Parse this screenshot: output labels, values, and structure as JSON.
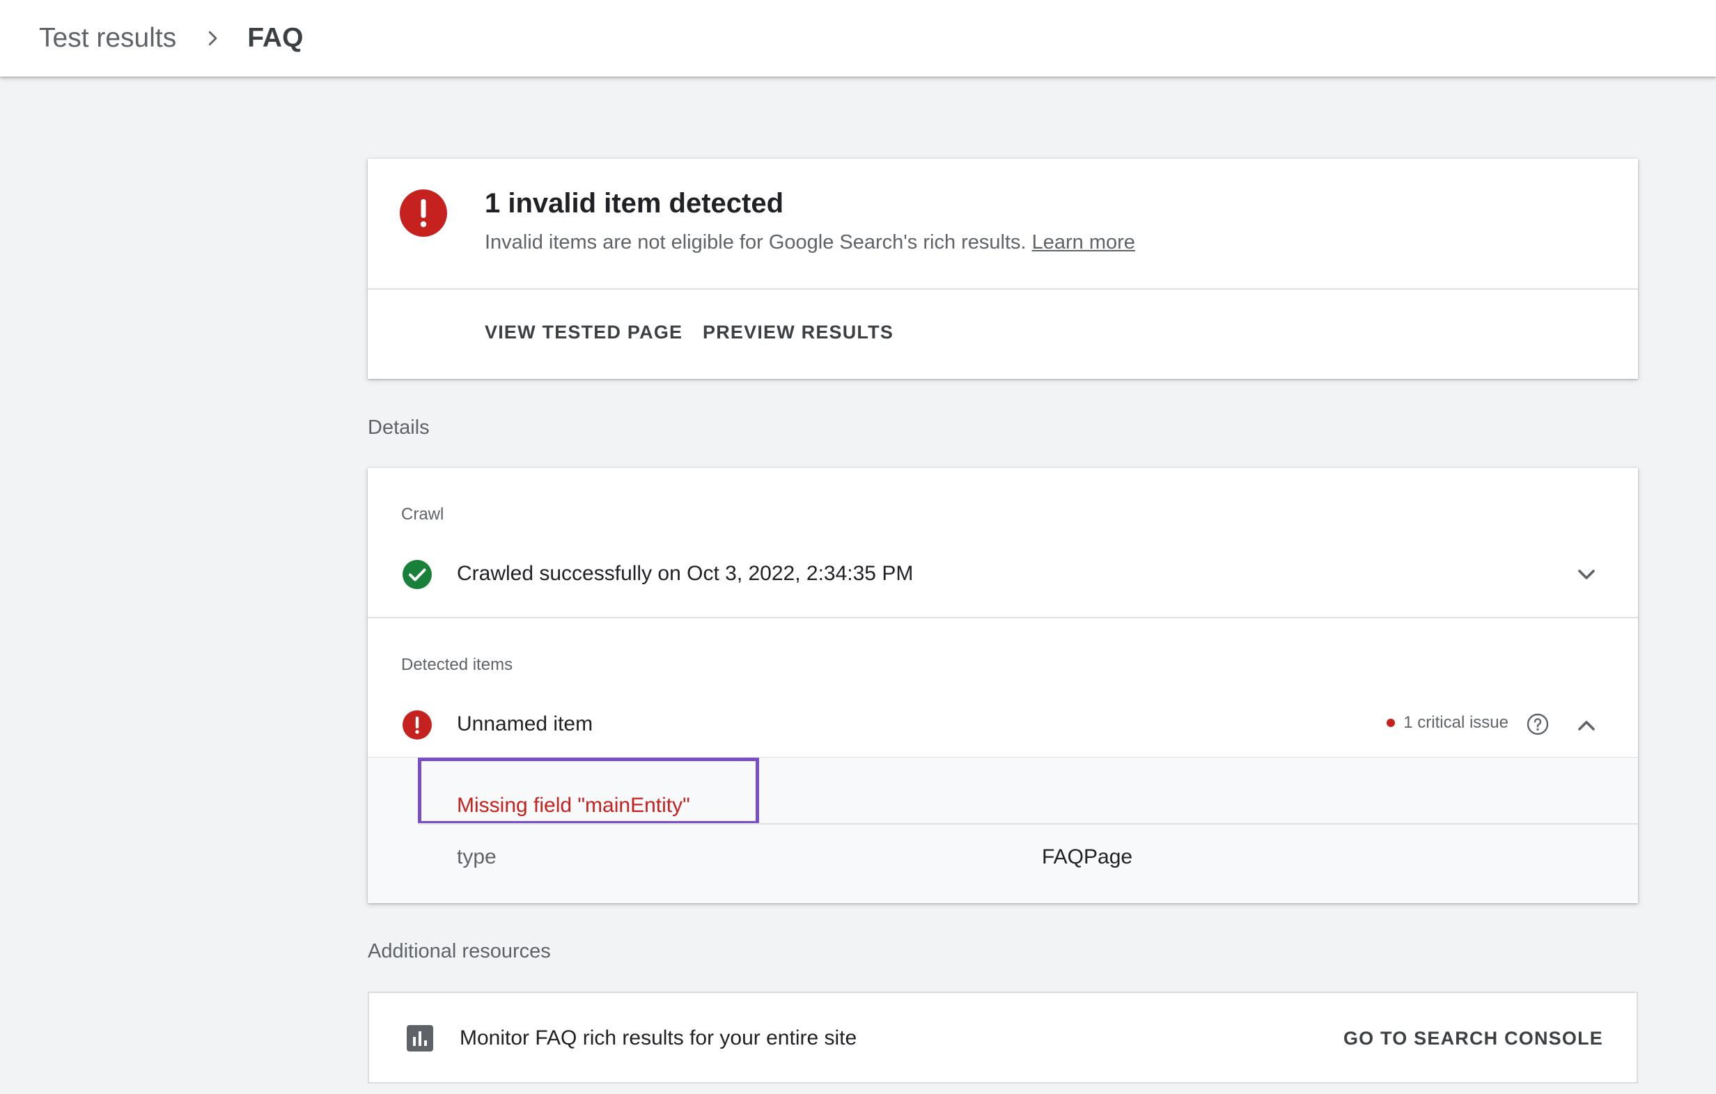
{
  "header": {
    "breadcrumb_parent": "Test results",
    "breadcrumb_current": "FAQ"
  },
  "summary": {
    "title": "1 invalid item detected",
    "subtitle": "Invalid items are not eligible for Google Search's rich results.",
    "learn_more": "Learn more",
    "actions": {
      "view_tested_page": "VIEW TESTED PAGE",
      "preview_results": "PREVIEW RESULTS"
    }
  },
  "details": {
    "section_label": "Details",
    "crawl": {
      "label": "Crawl",
      "status": "Crawled successfully on Oct 3, 2022, 2:34:35 PM"
    },
    "detected_items": {
      "label": "Detected items",
      "item_name": "Unnamed item",
      "issue_count": "1 critical issue",
      "issue_message": "Missing field \"mainEntity\"",
      "properties": [
        {
          "name": "type",
          "value": "FAQPage"
        }
      ]
    }
  },
  "resources": {
    "section_label": "Additional resources",
    "text": "Monitor FAQ rich results for your entire site",
    "button": "GO TO SEARCH CONSOLE"
  },
  "colors": {
    "error_red": "#c5221f",
    "success_green": "#188038",
    "highlight_purple": "#7a4fc4"
  },
  "icons": {
    "error": "error-icon",
    "success": "check-circle-icon",
    "chevron_right": "chevron-right-icon",
    "chevron_down": "chevron-down-icon",
    "chevron_up": "chevron-up-icon",
    "help": "help-icon",
    "chart": "bar-chart-icon"
  }
}
